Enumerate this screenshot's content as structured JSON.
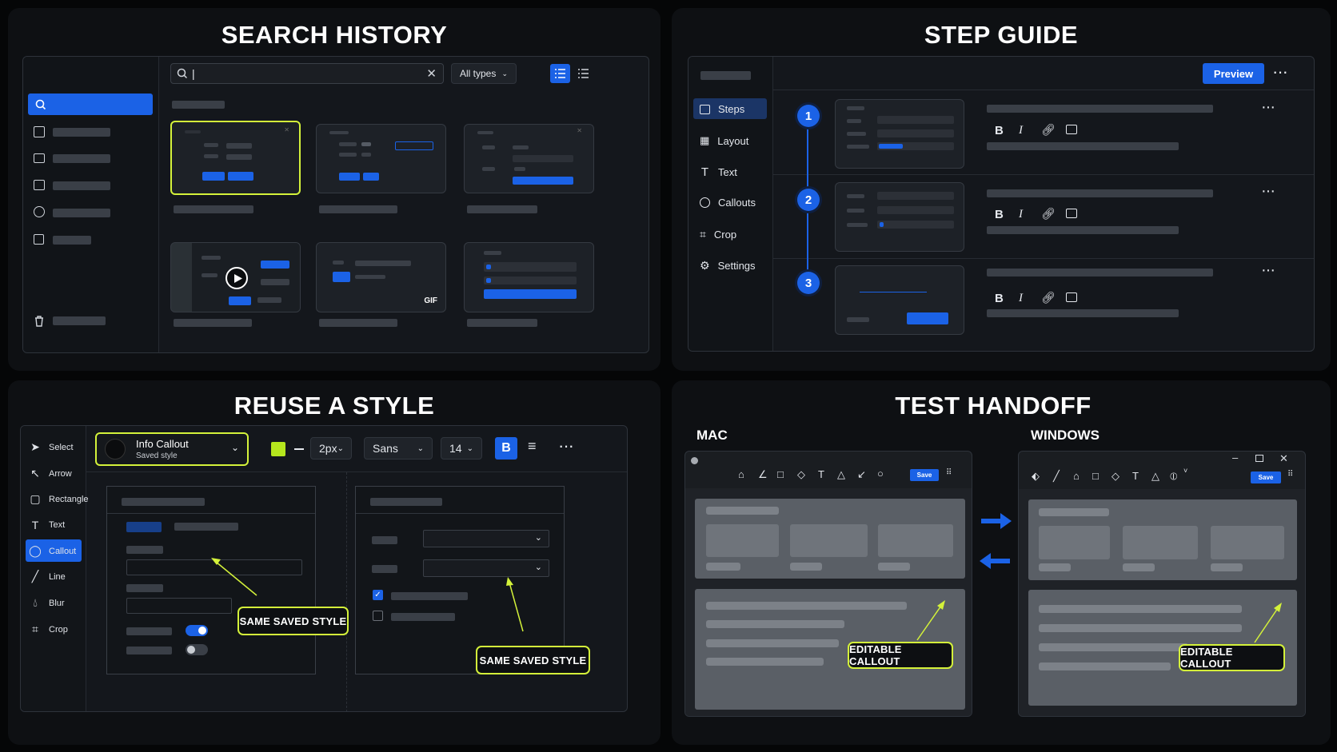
{
  "panels": {
    "search_history": {
      "title": "SEARCH HISTORY"
    },
    "step_guide": {
      "title": "STEP GUIDE"
    },
    "reuse_style": {
      "title": "REUSE A STYLE"
    },
    "test_handoff": {
      "title": "TEST HANDOFF"
    }
  },
  "search_history": {
    "search_value": "|",
    "filter": "All types",
    "gif_badge": "GIF"
  },
  "step_guide": {
    "preview_label": "Preview",
    "nav": [
      {
        "label": "Steps",
        "icon": "steps-icon"
      },
      {
        "label": "Layout",
        "icon": "layout-icon"
      },
      {
        "label": "Text",
        "icon": "text-icon"
      },
      {
        "label": "Callouts",
        "icon": "callout-icon"
      },
      {
        "label": "Crop",
        "icon": "crop-icon"
      },
      {
        "label": "Settings",
        "icon": "gear-icon"
      }
    ],
    "steps": [
      "1",
      "2",
      "3"
    ],
    "format_buttons": {
      "bold": "B",
      "italic": "I"
    }
  },
  "reuse_style": {
    "style_name": "Info Callout",
    "style_sub": "Saved style",
    "stroke_width": "2px",
    "font": "Sans",
    "font_size": "14",
    "bold": "B",
    "swatch_color": "#b5e61d",
    "tools": [
      {
        "label": "Select",
        "icon": "cursor-icon"
      },
      {
        "label": "Arrow",
        "icon": "arrow-icon"
      },
      {
        "label": "Rectangle",
        "icon": "rectangle-icon"
      },
      {
        "label": "Text",
        "icon": "text-icon"
      },
      {
        "label": "Callout",
        "icon": "callout-icon"
      },
      {
        "label": "Line",
        "icon": "line-icon"
      },
      {
        "label": "Blur",
        "icon": "blur-icon"
      },
      {
        "label": "Crop",
        "icon": "crop-icon"
      }
    ],
    "callout_left": "SAME SAVED STYLE",
    "callout_right": "SAME SAVED STYLE"
  },
  "test_handoff": {
    "mac_label": "MAC",
    "windows_label": "WINDOWS",
    "save_label": "Save",
    "callout_mac": "EDITABLE CALLOUT",
    "callout_win": "EDITABLE CALLOUT"
  },
  "colors": {
    "accent": "#1b62e6",
    "highlight": "#d4f23a"
  }
}
